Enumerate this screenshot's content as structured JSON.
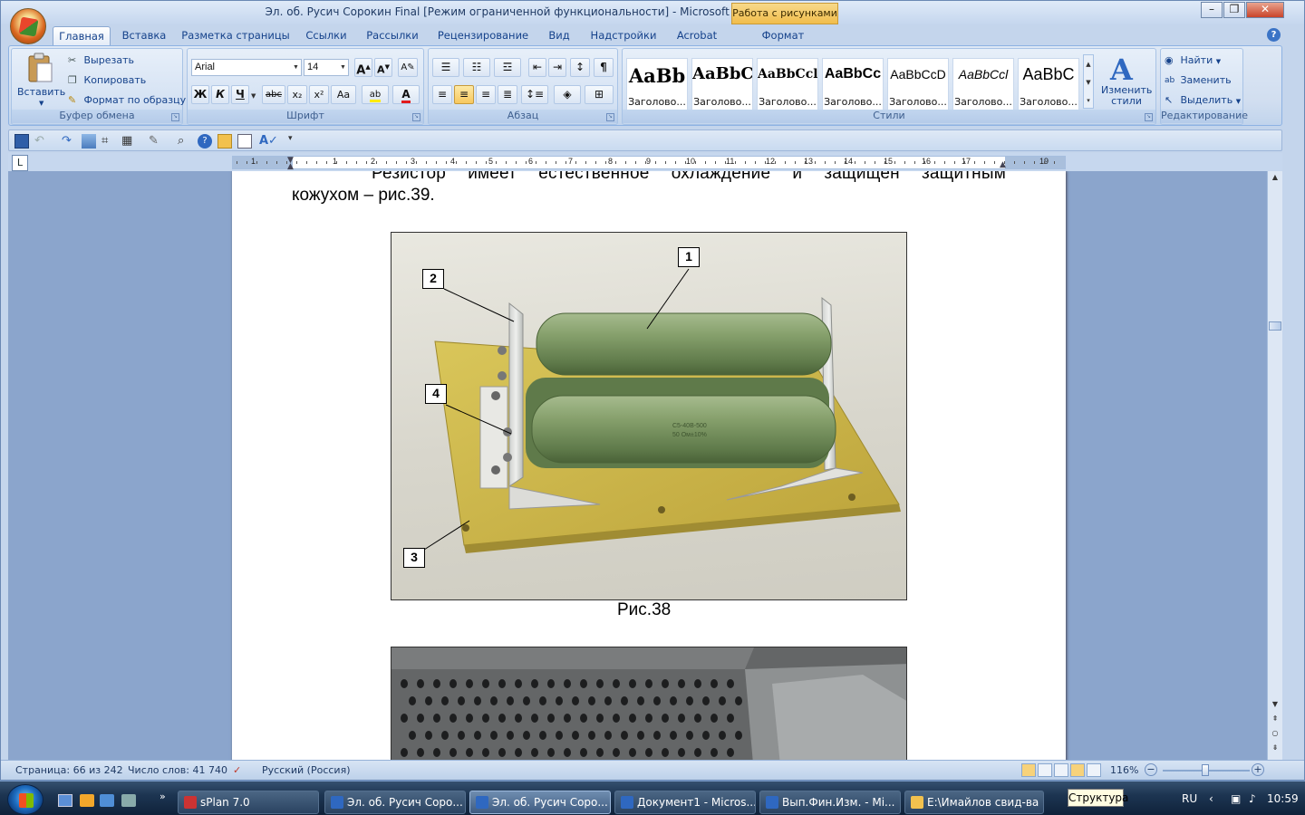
{
  "window": {
    "title": "Эл. об. Русич Сорокин Final [Режим ограниченной функциональности] - Microsoft Word",
    "context_tab_title": "Работа с рисунками"
  },
  "tabs": [
    "Главная",
    "Вставка",
    "Разметка страницы",
    "Ссылки",
    "Рассылки",
    "Рецензирование",
    "Вид",
    "Надстройки",
    "Acrobat",
    "Формат"
  ],
  "active_tab": "Главная",
  "ribbon": {
    "clipboard": {
      "label": "Буфер обмена",
      "paste": "Вставить",
      "cut": "Вырезать",
      "copy": "Копировать",
      "format_painter": "Формат по образцу"
    },
    "font": {
      "label": "Шрифт",
      "font_name": "Arial",
      "font_size": "14",
      "bold": "Ж",
      "italic": "К",
      "underline": "Ч",
      "strike": "abc",
      "subscript": "x₂",
      "superscript": "x²",
      "change_case": "Aa",
      "highlight": "ab",
      "font_color": "A"
    },
    "paragraph": {
      "label": "Абзац"
    },
    "styles": {
      "label": "Стили",
      "items": [
        {
          "sample": "AaBb",
          "name": "Заголово..."
        },
        {
          "sample": "AaBbC",
          "name": "Заголово..."
        },
        {
          "sample": "AaBbCcl",
          "name": "Заголово..."
        },
        {
          "sample": "AaBbCc",
          "name": "Заголово..."
        },
        {
          "sample": "AaBbCcD",
          "name": "Заголово..."
        },
        {
          "sample": "AaBbCcl",
          "name": "Заголово..."
        },
        {
          "sample": "AaBbC",
          "name": "Заголово..."
        }
      ],
      "change_styles": "Изменить стили"
    },
    "editing": {
      "label": "Редактирование",
      "find": "Найти",
      "replace": "Заменить",
      "select": "Выделить"
    }
  },
  "ruler": {
    "numbers": [
      "1",
      "1",
      "2",
      "3",
      "4",
      "5",
      "6",
      "7",
      "8",
      "9",
      "10",
      "11",
      "12",
      "13",
      "14",
      "15",
      "16",
      "17",
      "19"
    ]
  },
  "document": {
    "line1": "Резистор имеет естественное охлаждение и защищен защитным",
    "line2": "кожухом – рис.39.",
    "figure_caption": "Рис.38",
    "callouts": [
      "1",
      "2",
      "3",
      "4"
    ],
    "resistor_text_a": "С5-40В-500",
    "resistor_text_b": "50 Ом±10%"
  },
  "status": {
    "page": "Страница: 66 из 242",
    "words": "Число слов: 41 740",
    "language": "Русский (Россия)",
    "zoom": "116%"
  },
  "taskbar": {
    "items": [
      {
        "label": "sPlan 7.0",
        "active": false
      },
      {
        "label": "Эл. об. Русич Соро...",
        "active": false
      },
      {
        "label": "Эл. об. Русич Соро...",
        "active": true
      },
      {
        "label": "Документ1 - Micros...",
        "active": false
      },
      {
        "label": "Вып.Фин.Изм. - Mi...",
        "active": false
      },
      {
        "label": "E:\\Имайлов свид-ва",
        "active": false
      }
    ],
    "tooltip": "Структура",
    "lang": "RU",
    "time": "10:59"
  },
  "colors": {
    "accent": "#15428b",
    "ribbon_bg": "#d1def0",
    "taskbar": "#1d3552",
    "resistor_green": "#7d9a66",
    "board_yellow": "#c8b54a"
  }
}
